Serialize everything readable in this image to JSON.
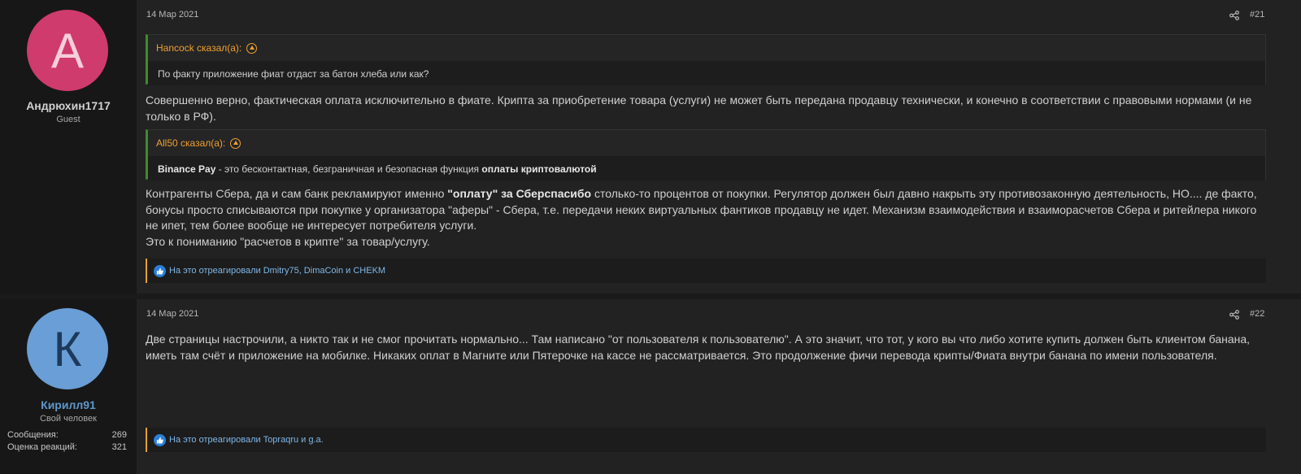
{
  "posts": [
    {
      "date": "14 Мар 2021",
      "number": "#21",
      "author": {
        "initial": "А",
        "name": "Андрюхин1717",
        "title": "Guest",
        "avatar_color": "#cf3b6d",
        "initial_color": "#f6cedc",
        "name_color": "#d0d0d0"
      },
      "quote1": {
        "author": "Hancock сказал(а):",
        "text": "По факту приложение фиат отдаст за батон хлеба или как?"
      },
      "text1": "Совершенно верно, фактическая оплата исключительно в фиате. Крипта за приобретение товара (услуги) не может быть передана продавцу технически, и конечно в соответствии с правовыми нормами (и не только в РФ).",
      "quote2": {
        "author": "All50 сказал(а):",
        "bold1": "Binance Pay",
        "mid": " - это бесконтактная, безграничная и безопасная функция ",
        "bold2": "оплаты криптовалютой"
      },
      "text2": {
        "pre": "Контрагенты Сбера, да и сам банк рекламируют именно ",
        "bold": "\"оплату\" за Сберспасибо",
        "post": " столько-то процентов от покупки. Регулятор должен был давно накрыть эту противозаконную деятельность, НО.... де факто, бонусы просто списываются при покупке у организатора \"аферы\" - Сбера, т.е. передачи неких виртуальных фантиков продавцу не идет. Механизм взаимодействия и взаиморасчетов Сбера и ритейлера никого не ипет, тем более вообще не интересует потребителя услуги.",
        "line2": "Это к пониманию \"расчетов в крипте\" за товар/услугу."
      },
      "reactions": "На это отреагировали Dmitry75, DimaCoin и CHEKM"
    },
    {
      "date": "14 Мар 2021",
      "number": "#22",
      "author": {
        "initial": "К",
        "name": "Кирилл91",
        "title": "Свой человек",
        "avatar_color": "#6a9ed6",
        "initial_color": "#1d3a5c",
        "name_color": "#5e97c9"
      },
      "stats": [
        {
          "label": "Сообщения:",
          "value": "269"
        },
        {
          "label": "Оценка реакций:",
          "value": "321"
        }
      ],
      "text": "Две страницы настрочили, а никто так и не смог прочитать нормально... Там написано \"от пользователя к пользователю\". А это значит, что тот, у кого вы что либо хотите купить должен быть клиентом банана, иметь там счёт и приложение на мобилке. Никаких оплат в Магните или Пятерочке на кассе не рассматривается. Это продолжение фичи перевода крипты/Фиата внутри банана по имени пользователя.",
      "reactions": "На это отреагировали Topraqru и g.a."
    }
  ]
}
